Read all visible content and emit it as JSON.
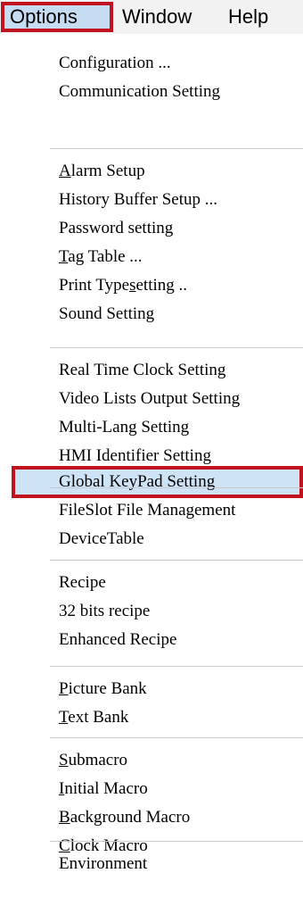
{
  "menubar": {
    "items": [
      {
        "label": "Options"
      },
      {
        "label": "Window"
      },
      {
        "label": "Help"
      }
    ]
  },
  "menu": {
    "groups": [
      [
        {
          "label": "Configuration ..."
        },
        {
          "label": "Communication Setting"
        }
      ],
      [
        {
          "label": "Alarm Setup",
          "mnemonic": "A"
        },
        {
          "label": "History Buffer Setup ..."
        },
        {
          "label": "Password setting"
        },
        {
          "label": "Tag Table ...",
          "mnemonic": "T"
        },
        {
          "label": "Print Typesetting ..",
          "mnemonic": "s"
        },
        {
          "label": "Sound Setting"
        }
      ],
      [
        {
          "label": "Real Time Clock Setting"
        },
        {
          "label": "Video Lists Output Setting"
        },
        {
          "label": "Multi-Lang Setting"
        },
        {
          "label": "HMI Identifier Setting"
        },
        {
          "label": "Global KeyPad Setting",
          "highlighted": true
        }
      ],
      [
        {
          "label": "FileSlot File Management"
        },
        {
          "label": "DeviceTable"
        }
      ],
      [
        {
          "label": "Recipe"
        },
        {
          "label": "32 bits recipe"
        },
        {
          "label": "Enhanced Recipe"
        }
      ],
      [
        {
          "label": "Picture Bank",
          "mnemonic": "P"
        },
        {
          "label": "Text Bank",
          "mnemonic": "T"
        }
      ],
      [
        {
          "label": "Submacro",
          "mnemonic": "S"
        },
        {
          "label": "Initial Macro",
          "mnemonic": "I"
        },
        {
          "label": "Background Macro",
          "mnemonic": "B"
        },
        {
          "label": "Clock Macro",
          "mnemonic": "C"
        }
      ],
      [
        {
          "label": "Environment"
        }
      ]
    ]
  },
  "colors": {
    "highlight_border": "#c0121f",
    "highlight_fill": "#cfe3f6",
    "separator": "#c8c8c8"
  }
}
